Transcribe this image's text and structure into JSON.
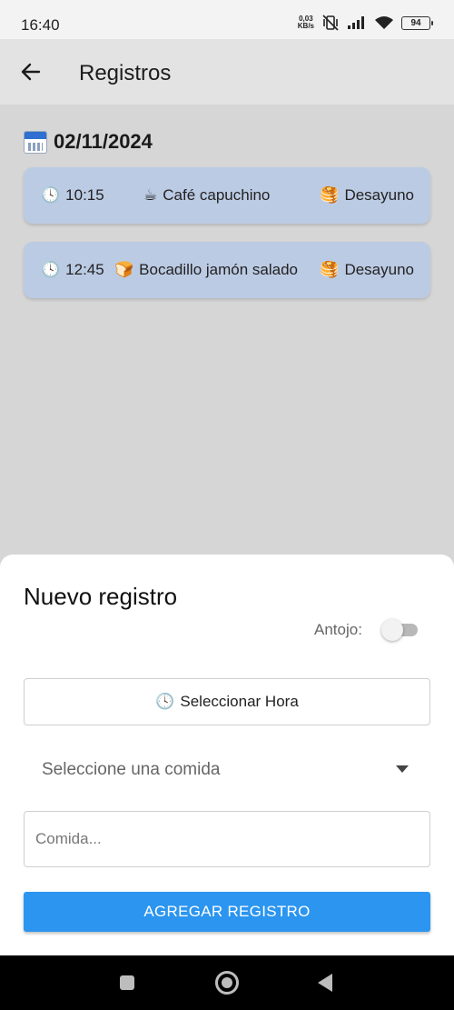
{
  "status_bar": {
    "time": "16:40",
    "net_speed_value": "0,03",
    "net_speed_unit": "KB/s",
    "battery": "94",
    "icons": [
      "vibrate-off-icon",
      "signal-icon",
      "wifi-icon",
      "battery-icon"
    ]
  },
  "app_bar": {
    "back_icon": "arrow-left-icon",
    "title": "Registros"
  },
  "records": {
    "date": "02/11/2024",
    "date_icon": "calendar-icon",
    "items": [
      {
        "time_icon": "🕓",
        "time": "10:15",
        "food_icon": "☕",
        "food": "Café capuchino",
        "meal_icon": "🥞",
        "meal": "Desayuno"
      },
      {
        "time_icon": "🕓",
        "time": "12:45",
        "food_icon": "🍞",
        "food": "Bocadillo jamón salado",
        "meal_icon": "🥞",
        "meal": "Desayuno"
      }
    ]
  },
  "new_record": {
    "title": "Nuevo registro",
    "craving_label": "Antojo:",
    "craving_on": false,
    "time_button_icon": "🕓",
    "time_button_label": "Seleccionar Hora",
    "meal_select_placeholder": "Seleccione una comida",
    "food_input_placeholder": "Comida...",
    "submit_label": "AGREGAR REGISTRO"
  },
  "colors": {
    "card": "#bccbe4",
    "primary": "#2b95ef",
    "app_bar": "#e3e3e3",
    "background": "#d6d6d6"
  }
}
